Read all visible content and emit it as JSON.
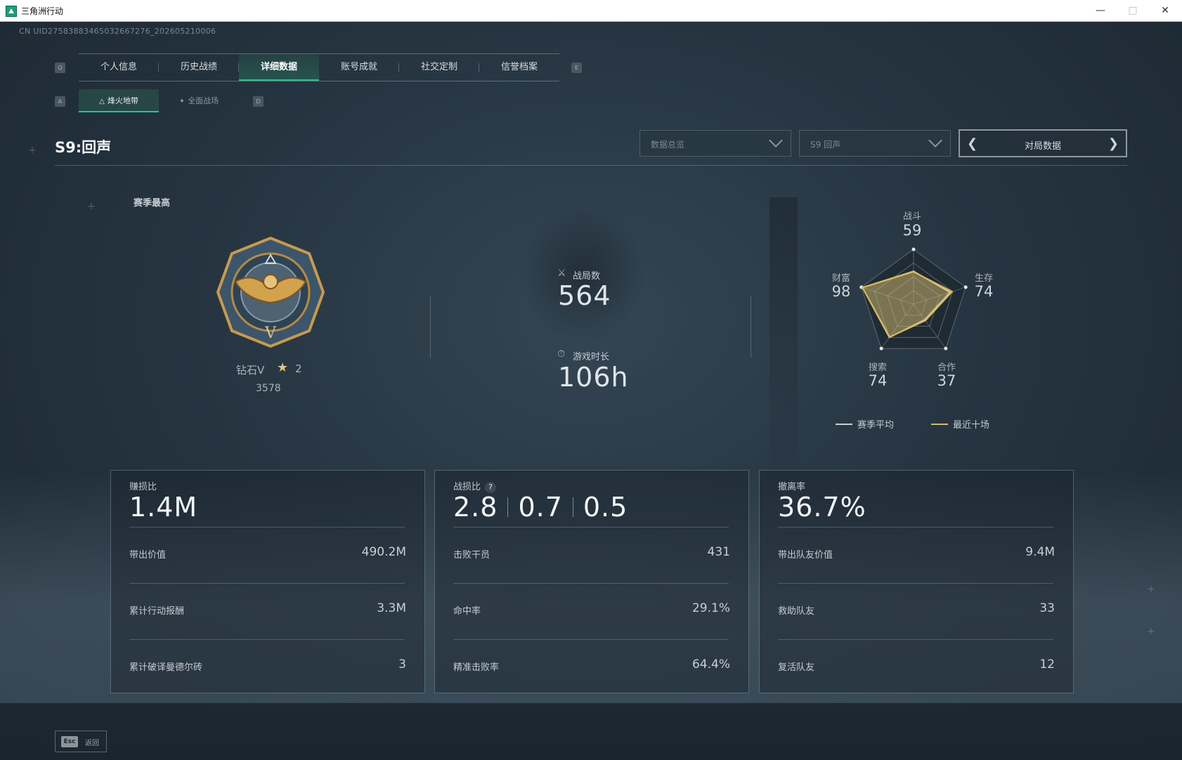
{
  "window": {
    "title": "三角洲行动"
  },
  "uid_text": "CN UID275838834650326672​76_202605210006",
  "nav": {
    "key_left": "Q",
    "key_right": "E",
    "tabs": [
      "个人信息",
      "历史战绩",
      "详细数据",
      "账号成就",
      "社交定制",
      "信誉档案"
    ],
    "active_tab": "详细数据"
  },
  "subnav": {
    "key_left": "A",
    "key_right": "D",
    "tabs": [
      "烽火地带",
      "全面战场"
    ],
    "active_tab": "烽火地带"
  },
  "season": {
    "title": "S9:回声"
  },
  "filters": {
    "view_select": "数据总览",
    "season_select": "S9 回声",
    "pager_label": "对局数据"
  },
  "rank": {
    "section_label": "赛季最高",
    "name": "钻石V",
    "stars": "2",
    "score": "3578"
  },
  "summary": {
    "matches_label": "战局数",
    "matches_value": "564",
    "playtime_label": "游戏时长",
    "playtime_value": "106h"
  },
  "radar": {
    "axes": [
      {
        "label": "战斗",
        "value": 59
      },
      {
        "label": "生存",
        "value": 74
      },
      {
        "label": "合作",
        "value": 37
      },
      {
        "label": "搜索",
        "value": 74
      },
      {
        "label": "财富",
        "value": 98
      }
    ],
    "recent_values": [
      59,
      74,
      37,
      74,
      98
    ],
    "average_values": [
      60,
      70,
      35,
      75,
      98
    ],
    "legend": {
      "average": "赛季平均",
      "recent": "最近十场"
    },
    "colors": {
      "average": "#c9d1d6",
      "recent": "#e0b94a"
    }
  },
  "cards": [
    {
      "title": "赚损比",
      "big": "1.4M",
      "rows": [
        {
          "label": "带出价值",
          "value": "490.2M"
        },
        {
          "label": "累计行动报酬",
          "value": "3.3M"
        },
        {
          "label": "累计破译曼德尔砖",
          "value": "3"
        }
      ]
    },
    {
      "title": "战损比",
      "big_values": [
        "2.8",
        "0.7",
        "0.5"
      ],
      "help": "?",
      "rows": [
        {
          "label": "击败干员",
          "value": "431"
        },
        {
          "label": "命中率",
          "value": "29.1%"
        },
        {
          "label": "精准击败率",
          "value": "64.4%"
        }
      ]
    },
    {
      "title": "撤离率",
      "big": "36.7%",
      "rows": [
        {
          "label": "带出队友价值",
          "value": "9.4M"
        },
        {
          "label": "救助队友",
          "value": "33"
        },
        {
          "label": "复活队友",
          "value": "12"
        }
      ]
    }
  ],
  "footer": {
    "esc_key": "Esc",
    "back_label": "返回"
  },
  "accent_color": "#2fc08e"
}
